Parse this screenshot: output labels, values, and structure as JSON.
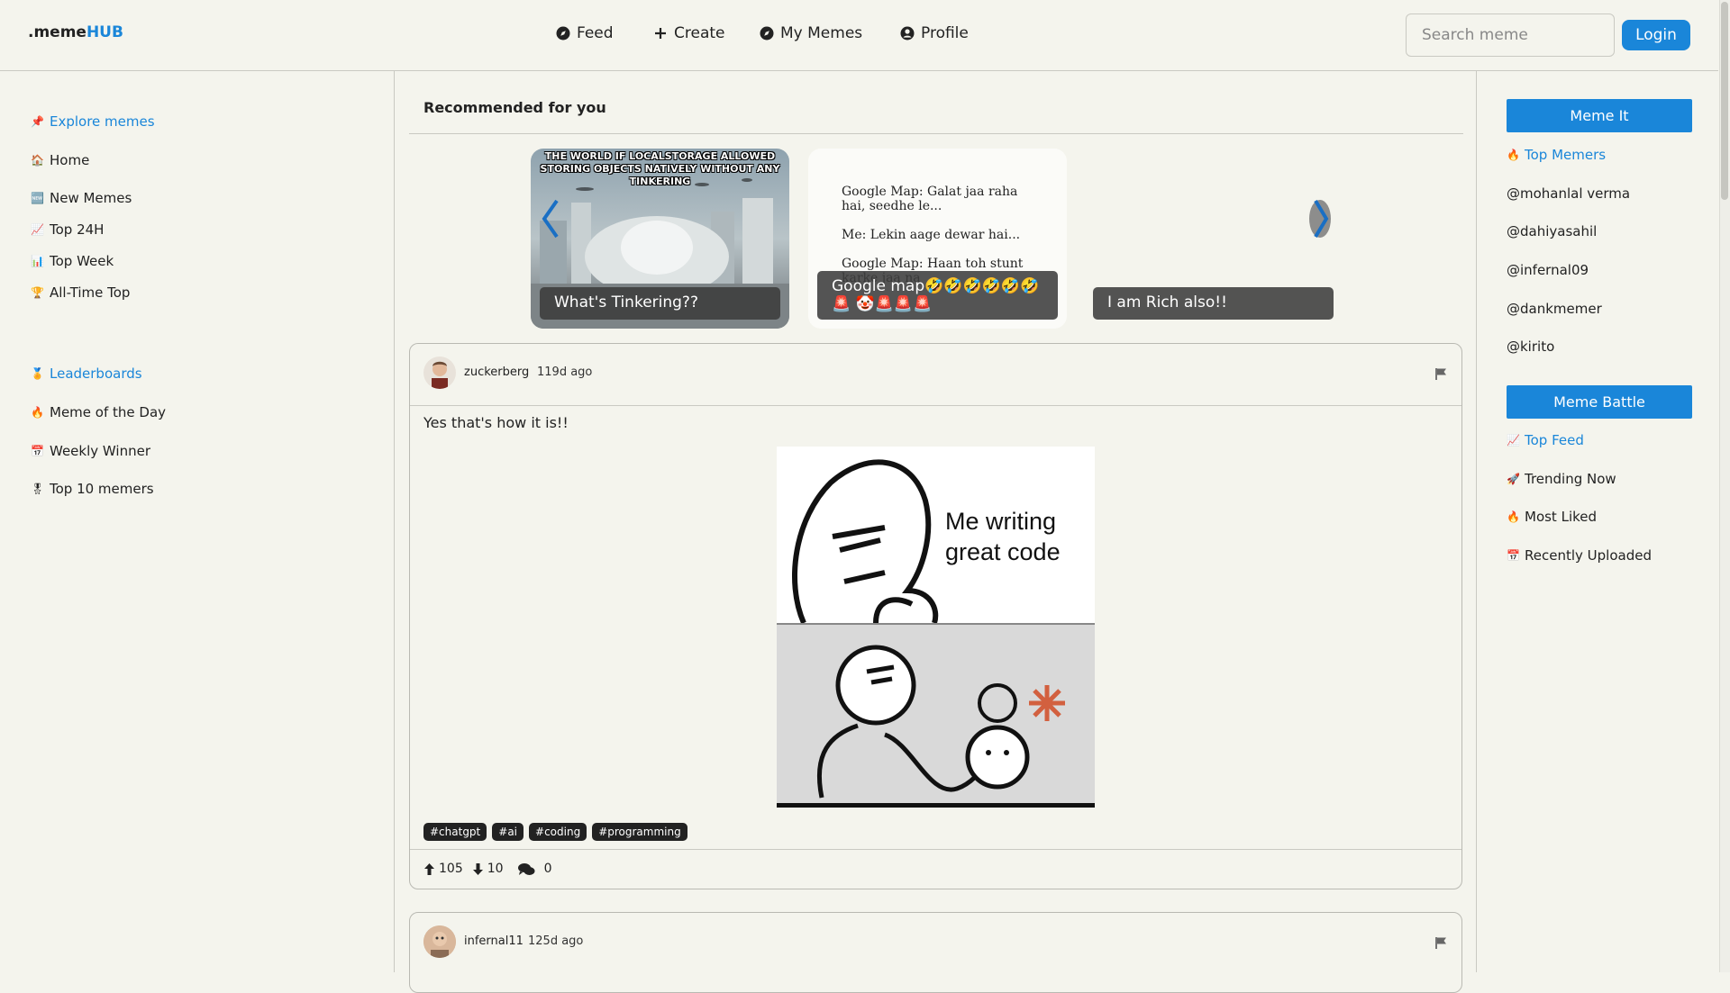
{
  "header": {
    "logo_prefix": ".meme",
    "logo_suffix": "HUB",
    "nav": [
      {
        "label": "Feed",
        "icon": "compass-icon"
      },
      {
        "label": "Create",
        "icon": "plus-icon"
      },
      {
        "label": "My Memes",
        "icon": "compass-icon"
      },
      {
        "label": "Profile",
        "icon": "user-circle-icon"
      }
    ],
    "search_placeholder": "Search meme",
    "login_label": "Login"
  },
  "left_sidebar": {
    "explore_heading": "Explore memes",
    "explore_items": [
      "Home",
      "New Memes",
      "Top 24H",
      "Top Week",
      "All-Time Top"
    ],
    "leaderboards_heading": "Leaderboards",
    "leaderboard_items": [
      "Meme of the Day",
      "Weekly Winner",
      "Top 10 memers"
    ]
  },
  "recommended": {
    "title": "Recommended for you",
    "cards": [
      {
        "caption": "What's Tinkering??",
        "image_text": "THE WORLD IF LOCALSTORAGE ALLOWED STORING OBJECTS NATIVELY WITHOUT ANY TINKERING"
      },
      {
        "caption": "Google map🤣🤣🤣🤣🤣🤣🚨 🤡🚨🚨🚨",
        "lines": [
          "Google Map: Galat jaa raha hai, seedhe le...",
          "Me: Lekin aage dewar hai...",
          "Google Map: Haan toh stunt karke jaa na"
        ]
      },
      {
        "caption": "I am Rich also!!"
      }
    ]
  },
  "posts": [
    {
      "username": "zuckerberg",
      "ago": "119d ago",
      "text": "Yes that's how it is!!",
      "image_text": "Me writing great code",
      "tags": [
        "#chatgpt",
        "#ai",
        "#coding",
        "#programming"
      ],
      "upvotes": "105",
      "downvotes": "10",
      "comments": "0"
    },
    {
      "username": "infernal11",
      "ago": "125d ago"
    }
  ],
  "right_sidebar": {
    "meme_it_label": "Meme It",
    "top_memers_heading": "Top Memers",
    "memers": [
      "@mohanlal verma",
      "@dahiyasahil",
      "@infernal09",
      "@dankmemer",
      "@kirito"
    ],
    "meme_battle_label": "Meme Battle",
    "top_feed_heading": "Top Feed",
    "feed_items": [
      "Trending Now",
      "Most Liked",
      "Recently Uploaded"
    ]
  },
  "colors": {
    "accent": "#1a86d9",
    "background": "#f4f4ed"
  }
}
